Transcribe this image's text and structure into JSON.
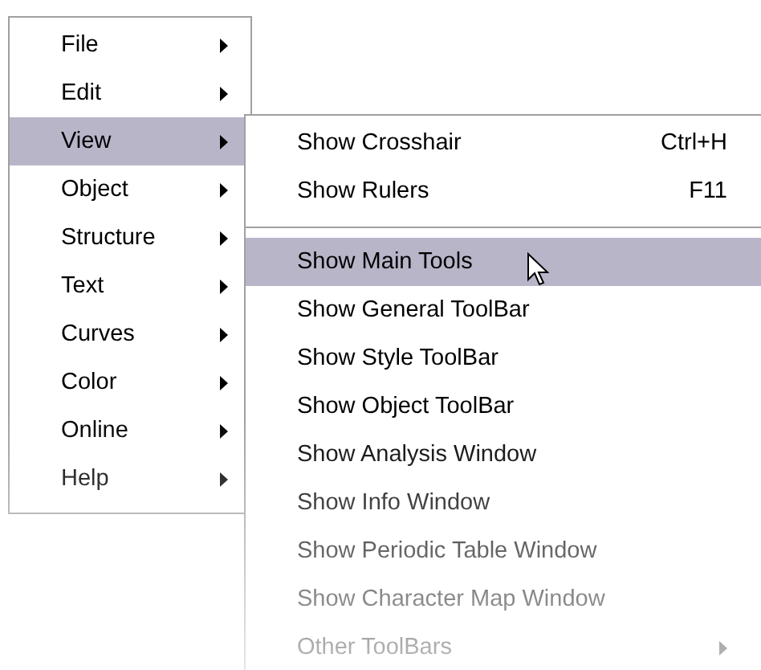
{
  "menu": {
    "items": [
      {
        "label": "File",
        "selected": false,
        "has_submenu": true
      },
      {
        "label": "Edit",
        "selected": false,
        "has_submenu": true
      },
      {
        "label": "View",
        "selected": true,
        "has_submenu": true
      },
      {
        "label": "Object",
        "selected": false,
        "has_submenu": true
      },
      {
        "label": "Structure",
        "selected": false,
        "has_submenu": true
      },
      {
        "label": "Text",
        "selected": false,
        "has_submenu": true
      },
      {
        "label": "Curves",
        "selected": false,
        "has_submenu": true
      },
      {
        "label": "Color",
        "selected": false,
        "has_submenu": true
      },
      {
        "label": "Online",
        "selected": false,
        "has_submenu": true
      },
      {
        "label": "Help",
        "selected": false,
        "has_submenu": true
      }
    ]
  },
  "submenu": {
    "items": [
      {
        "kind": "item",
        "label": "Show Crosshair",
        "shortcut": "Ctrl+H",
        "selected": false
      },
      {
        "kind": "item",
        "label": "Show Rulers",
        "shortcut": "F11",
        "selected": false
      },
      {
        "kind": "separator"
      },
      {
        "kind": "item",
        "label": "Show Main Tools",
        "selected": true
      },
      {
        "kind": "item",
        "label": "Show General ToolBar",
        "selected": false
      },
      {
        "kind": "item",
        "label": "Show Style ToolBar",
        "selected": false
      },
      {
        "kind": "item",
        "label": "Show Object ToolBar",
        "selected": false
      },
      {
        "kind": "item",
        "label": "Show Analysis Window",
        "selected": false
      },
      {
        "kind": "item",
        "label": "Show Info Window",
        "selected": false
      },
      {
        "kind": "item",
        "label": "Show Periodic Table Window",
        "selected": false
      },
      {
        "kind": "item",
        "label": "Show Character Map Window",
        "selected": false
      },
      {
        "kind": "item",
        "label": "Other ToolBars",
        "selected": false,
        "has_submenu": true
      }
    ]
  }
}
